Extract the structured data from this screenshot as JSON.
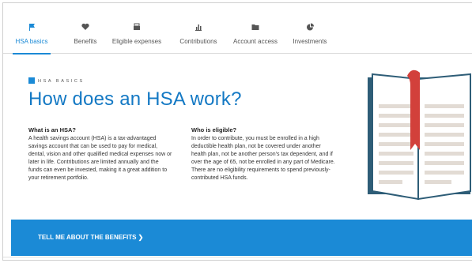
{
  "tabs": [
    {
      "label": "HSA basics",
      "icon": "flag-icon",
      "active": true
    },
    {
      "label": "Benefits",
      "icon": "heart-icon",
      "active": false
    },
    {
      "label": "Eligible expenses",
      "icon": "register-icon",
      "active": false
    },
    {
      "label": "Contributions",
      "icon": "bar-chart-icon",
      "active": false
    },
    {
      "label": "Account access",
      "icon": "folder-icon",
      "active": false
    },
    {
      "label": "Investments",
      "icon": "pie-icon",
      "active": false
    }
  ],
  "section": {
    "eyebrow": "HSA BASICS",
    "title": "How does an HSA work?"
  },
  "what": {
    "heading": "What is an HSA?",
    "lines": [
      "A health savings account (HSA) is a tax-advantaged",
      "savings account that can be used to pay for medical,",
      "dental, vision and other qualified medical expenses now or",
      "later in life. Contributions are limited annually and the",
      "funds can even be invested, making it a great addition to",
      "your retirement portfolio."
    ]
  },
  "who": {
    "heading": "Who is eligible?",
    "lines": [
      "In order to contribute, you must be enrolled in a high",
      "deductible health plan, not be covered under another",
      "health plan, not be another person's tax dependent, and if",
      "over the age of 65, not be enrolled in any part of Medicare.",
      "There are no eligibility requirements to spend previously-",
      "contributed HSA funds."
    ]
  },
  "cta": {
    "label": "TELL ME ABOUT THE BENEFITS ❯"
  },
  "colors": {
    "accent": "#1b8ad6",
    "title": "#1479c4",
    "book_page": "#ffffff",
    "book_cover": "#2e5d77",
    "ribbon": "#d2403b"
  }
}
